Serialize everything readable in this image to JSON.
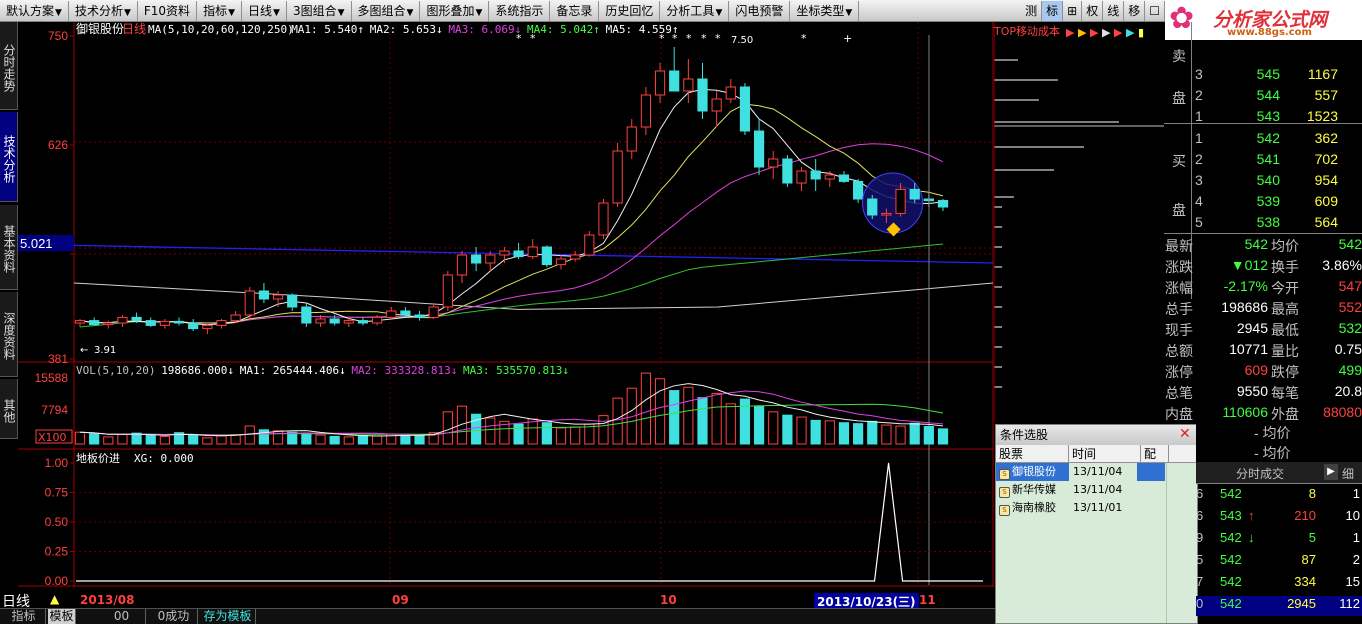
{
  "toolbar": {
    "items": [
      {
        "label": "默认方案",
        "dd": true
      },
      {
        "label": "技术分析",
        "dd": true
      },
      {
        "label": "F10资料",
        "dd": false
      },
      {
        "label": "指标",
        "dd": true
      },
      {
        "label": "日线",
        "dd": true
      },
      {
        "label": "3图组合",
        "dd": true
      },
      {
        "label": "多图组合",
        "dd": true
      },
      {
        "label": "图形叠加",
        "dd": true
      },
      {
        "label": "系统指示",
        "dd": false
      },
      {
        "label": "备忘录",
        "dd": false
      },
      {
        "label": "历史回忆",
        "dd": false
      },
      {
        "label": "分析工具",
        "dd": true
      },
      {
        "label": "闪电预警",
        "dd": false
      },
      {
        "label": "坐标类型",
        "dd": true
      }
    ],
    "right_tools": [
      "测",
      "标",
      "⊞",
      "权",
      "线",
      "移",
      "☐"
    ]
  },
  "logo": {
    "title": "分析家公式网",
    "url": "www.88gs.com"
  },
  "left_tabs": [
    "分时走势",
    "技术分析",
    "基本资料",
    "深度资料",
    "其他"
  ],
  "chart": {
    "title": "御银股份",
    "period": "日线",
    "ma_legend": "MA(5,10,20,60,120,250)",
    "ma1": "MA1: 5.540↑",
    "ma2": "MA2: 5.653↓",
    "ma3": "MA3: 6.069↓",
    "ma4": "MA4: 5.042↑",
    "ma5": "MA5: 4.559↑",
    "price_labels": {
      "top": "750",
      "mid": "626",
      "current": "5.021",
      "bottom": "381"
    },
    "low_label": "3.91",
    "high_label": "7.50",
    "vol_legend": "VOL(5,10,20)",
    "vol_val": "198686.000↓",
    "vol_ma1": "MA1: 265444.406↓",
    "vol_ma2": "MA2: 333328.813↓",
    "vol_ma3": "MA3: 535570.813↓",
    "vol_labels": {
      "top": "15588",
      "mid": "7794",
      "unit": "X100"
    },
    "ind_legend": "地板价进",
    "ind_val": "XG: 0.000",
    "ind_labels": [
      "1.00",
      "0.75",
      "0.50",
      "0.25",
      "0.00"
    ],
    "dates": [
      "2013/08",
      "09",
      "10",
      "2013/10/23(三)",
      "11"
    ],
    "cost_label": "TOP移动成本",
    "candles": [
      [
        4.05,
        4.1,
        4.0,
        4.08
      ],
      [
        4.08,
        4.12,
        4.02,
        4.03
      ],
      [
        4.03,
        4.08,
        3.98,
        4.05
      ],
      [
        4.05,
        4.15,
        4.0,
        4.12
      ],
      [
        4.12,
        4.18,
        4.05,
        4.08
      ],
      [
        4.08,
        4.12,
        4.0,
        4.02
      ],
      [
        4.02,
        4.1,
        3.98,
        4.07
      ],
      [
        4.07,
        4.12,
        4.02,
        4.05
      ],
      [
        4.05,
        4.1,
        3.95,
        3.98
      ],
      [
        3.98,
        4.05,
        3.91,
        4.02
      ],
      [
        4.02,
        4.1,
        3.98,
        4.08
      ],
      [
        4.08,
        4.2,
        4.05,
        4.15
      ],
      [
        4.15,
        4.5,
        4.1,
        4.45
      ],
      [
        4.45,
        4.55,
        4.3,
        4.35
      ],
      [
        4.35,
        4.45,
        4.25,
        4.4
      ],
      [
        4.4,
        4.42,
        4.2,
        4.25
      ],
      [
        4.25,
        4.3,
        4.0,
        4.05
      ],
      [
        4.05,
        4.15,
        4.0,
        4.1
      ],
      [
        4.1,
        4.15,
        4.02,
        4.05
      ],
      [
        4.05,
        4.12,
        4.0,
        4.08
      ],
      [
        4.08,
        4.12,
        4.02,
        4.05
      ],
      [
        4.05,
        4.15,
        4.02,
        4.12
      ],
      [
        4.12,
        4.25,
        4.1,
        4.2
      ],
      [
        4.2,
        4.25,
        4.12,
        4.15
      ],
      [
        4.15,
        4.2,
        4.08,
        4.12
      ],
      [
        4.12,
        4.3,
        4.1,
        4.25
      ],
      [
        4.25,
        4.7,
        4.2,
        4.65
      ],
      [
        4.65,
        4.95,
        4.55,
        4.9
      ],
      [
        4.9,
        5.0,
        4.7,
        4.8
      ],
      [
        4.8,
        4.95,
        4.7,
        4.9
      ],
      [
        4.9,
        5.0,
        4.8,
        4.95
      ],
      [
        4.95,
        5.05,
        4.85,
        4.88
      ],
      [
        4.88,
        5.1,
        4.85,
        5.0
      ],
      [
        5.0,
        5.02,
        4.75,
        4.78
      ],
      [
        4.78,
        4.9,
        4.72,
        4.85
      ],
      [
        4.85,
        4.95,
        4.82,
        4.9
      ],
      [
        4.9,
        5.2,
        4.88,
        5.15
      ],
      [
        5.15,
        5.6,
        5.1,
        5.55
      ],
      [
        5.55,
        6.3,
        5.5,
        6.2
      ],
      [
        6.2,
        6.6,
        6.1,
        6.5
      ],
      [
        6.5,
        7.0,
        6.4,
        6.9
      ],
      [
        6.9,
        7.3,
        6.8,
        7.2
      ],
      [
        7.2,
        7.5,
        7.0,
        6.95
      ],
      [
        6.95,
        7.35,
        6.8,
        7.1
      ],
      [
        7.1,
        7.3,
        6.6,
        6.7
      ],
      [
        6.7,
        6.95,
        6.5,
        6.85
      ],
      [
        6.85,
        7.1,
        6.8,
        7.0
      ],
      [
        7.0,
        7.05,
        6.4,
        6.45
      ],
      [
        6.45,
        6.6,
        5.9,
        6.0
      ],
      [
        6.0,
        6.2,
        5.85,
        6.1
      ],
      [
        6.1,
        6.15,
        5.75,
        5.8
      ],
      [
        5.8,
        6.0,
        5.7,
        5.95
      ],
      [
        5.95,
        6.1,
        5.7,
        5.85
      ],
      [
        5.85,
        5.95,
        5.75,
        5.9
      ],
      [
        5.9,
        5.95,
        5.8,
        5.82
      ],
      [
        5.82,
        5.85,
        5.55,
        5.6
      ],
      [
        5.6,
        5.65,
        5.35,
        5.4
      ],
      [
        5.4,
        5.48,
        5.3,
        5.42
      ],
      [
        5.42,
        5.8,
        5.38,
        5.72
      ],
      [
        5.72,
        5.8,
        5.55,
        5.6
      ],
      [
        5.6,
        5.68,
        5.5,
        5.58
      ],
      [
        5.58,
        5.6,
        5.45,
        5.5
      ]
    ],
    "volumes": [
      2.5,
      2.2,
      1.5,
      2.0,
      2.3,
      1.9,
      1.6,
      2.4,
      1.8,
      1.3,
      1.7,
      2.0,
      3.8,
      3.0,
      2.8,
      2.5,
      2.1,
      1.9,
      1.6,
      1.5,
      1.8,
      1.7,
      2.1,
      2.0,
      1.7,
      2.4,
      6.8,
      8.0,
      6.3,
      5.5,
      4.8,
      4.2,
      5.3,
      4.5,
      3.4,
      3.6,
      4.2,
      6.0,
      9.7,
      11.8,
      15.0,
      13.8,
      11.3,
      12.0,
      9.8,
      10.7,
      8.5,
      9.5,
      8.0,
      6.8,
      6.1,
      5.7,
      5.0,
      4.9,
      4.5,
      4.3,
      4.8,
      4.0,
      3.8,
      4.4,
      3.7,
      3.2
    ],
    "ind_signals": [
      58
    ]
  },
  "right": {
    "sell": [
      {
        "n": "3",
        "p": "545",
        "v": "1167"
      },
      {
        "n": "2",
        "p": "544",
        "v": "557"
      },
      {
        "n": "1",
        "p": "543",
        "v": "1523"
      }
    ],
    "buy": [
      {
        "n": "1",
        "p": "542",
        "v": "362"
      },
      {
        "n": "2",
        "p": "541",
        "v": "702"
      },
      {
        "n": "3",
        "p": "540",
        "v": "954"
      },
      {
        "n": "4",
        "p": "539",
        "v": "609"
      },
      {
        "n": "5",
        "p": "538",
        "v": "564"
      }
    ],
    "sell_label": [
      "卖",
      "盘"
    ],
    "buy_label": [
      "买",
      "盘"
    ],
    "stats": [
      {
        "l": "最新",
        "v": "542",
        "vc": "grn",
        "l2": "均价",
        "v2": "542",
        "v2c": "grn"
      },
      {
        "l": "涨跌",
        "v": "▼012",
        "vc": "grn",
        "l2": "换手",
        "v2": "3.86%",
        "v2c": "wht"
      },
      {
        "l": "涨幅",
        "v": "-2.17%",
        "vc": "grn",
        "l2": "今开",
        "v2": "547",
        "v2c": "red"
      },
      {
        "l": "总手",
        "v": "198686",
        "vc": "wht",
        "l2": "最高",
        "v2": "552",
        "v2c": "red"
      },
      {
        "l": "现手",
        "v": "2945",
        "vc": "wht",
        "l2": "最低",
        "v2": "532",
        "v2c": "grn"
      },
      {
        "l": "总额",
        "v": "10771",
        "vc": "wht",
        "l2": "量比",
        "v2": "0.75",
        "v2c": "wht"
      },
      {
        "l": "涨停",
        "v": "609",
        "vc": "red",
        "l2": "跌停",
        "v2": "499",
        "v2c": "grn"
      },
      {
        "l": "总笔",
        "v": "9550",
        "vc": "wht",
        "l2": "每笔",
        "v2": "20.8",
        "v2c": "wht"
      },
      {
        "l": "内盘",
        "v": "110606",
        "vc": "grn",
        "l2": "外盘",
        "v2": "88080",
        "v2c": "red"
      }
    ],
    "avg_rows": [
      "- 均价",
      "- 均价"
    ],
    "ticks_header": "分时成交",
    "ticks_tab": "细",
    "ticks": [
      {
        "t": "6",
        "p": "542",
        "a": "",
        "v": "8",
        "n": "1"
      },
      {
        "t": "6",
        "p": "543",
        "a": "↑",
        "v": "210",
        "n": "10"
      },
      {
        "t": "9",
        "p": "542",
        "a": "↓",
        "v": "5",
        "n": "1"
      },
      {
        "t": "5",
        "p": "542",
        "a": "",
        "v": "87",
        "n": "2"
      },
      {
        "t": "7",
        "p": "542",
        "a": "",
        "v": "334",
        "n": "15"
      },
      {
        "t": "0",
        "p": "542",
        "a": "",
        "v": "2945",
        "n": "112"
      }
    ]
  },
  "popup": {
    "title": "条件选股",
    "headers": [
      "股票",
      "时间",
      "配"
    ],
    "rows": [
      {
        "name": "御银股份",
        "time": "13/11/04",
        "sel": true
      },
      {
        "name": "新华传媒",
        "time": "13/11/04",
        "sel": false
      },
      {
        "name": "海南橡胶",
        "time": "13/11/01",
        "sel": false
      }
    ]
  },
  "bottom": {
    "period": "日线",
    "tabs": [
      "指标",
      "模板",
      "00",
      "0成功",
      "存为模板"
    ]
  }
}
